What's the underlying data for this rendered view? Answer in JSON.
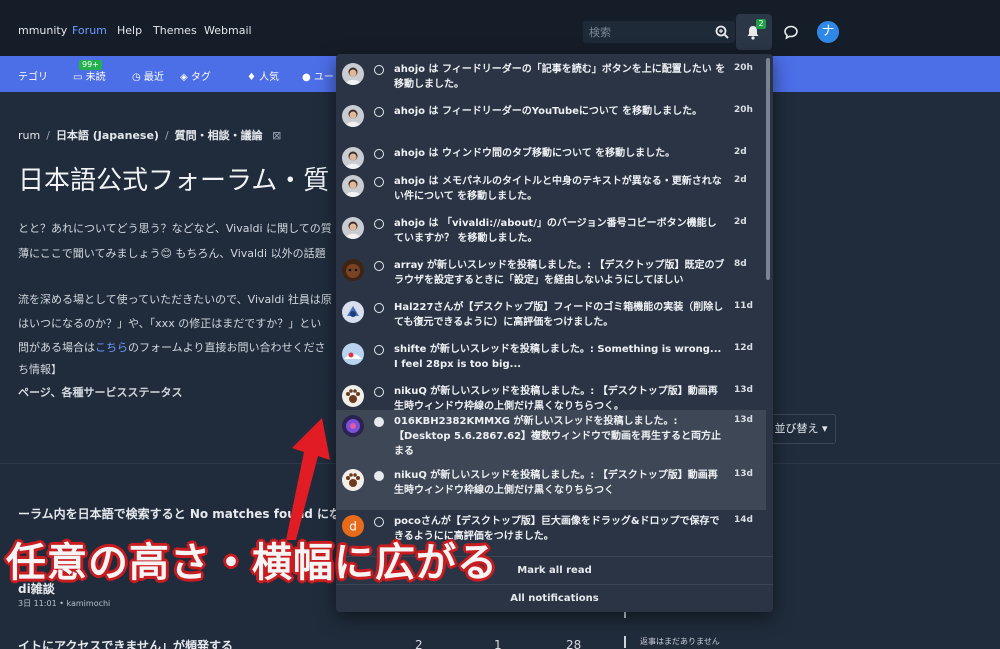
{
  "topnav": {
    "items": [
      "mmunity",
      "Forum",
      "Help",
      "Themes",
      "Webmail"
    ],
    "search_placeholder": "検索",
    "notification_count": "2"
  },
  "forumnav": {
    "items": [
      "テゴリ",
      "未読",
      "最近",
      "タグ",
      "人気",
      "ユー"
    ],
    "unread_badge": "99+"
  },
  "page": {
    "breadcrumb": [
      "rum",
      "日本語 (Japanese)",
      "質問・相談・議論"
    ],
    "title": "日本語公式フォーラム・質",
    "intro_line1": "とと？あれについてどう思う？などなど、Vivaldi に関しての質",
    "intro_line2": "薄にここで聞いてみましょう😊 もちろん、Vivaldi 以外の話題",
    "para_line1": "流を深める場として使っていただきたいので、Vivaldi 社員は原",
    "para_line2": "はいつになるのか？」や、「xxx の修正はまだですか？」とい",
    "para_line3_a": "問がある場合は",
    "para_line3_link": "こちら",
    "para_line3_b": "のフォームより直接お問い合わせくださ",
    "info_heading": "ち情報】",
    "info_links": "ページ、各種サービスステータス",
    "sort_button": "並び替え",
    "topic1": "ーラム内を日本語で検索すると No matches found にな",
    "topic2_title": "di雑談",
    "topic2_meta": "3日 11:01 • kamimochi",
    "topic3": "イトにアクセスできません」が頻発する",
    "topic3_stats": [
      "2",
      "1",
      "28"
    ],
    "topic3_reply": "返事はまだありません"
  },
  "notifications": {
    "items": [
      {
        "text": "ahojo は フィードリーダーの「記事を読む」ボタンを上に配置したい を移動しました。",
        "time": "20h",
        "avatar": "person",
        "unread": false
      },
      {
        "text": "ahojo は フィードリーダーのYouTubeについて を移動しました。",
        "time": "20h",
        "avatar": "person",
        "unread": false
      },
      {
        "text": "ahojo は ウィンドウ間のタブ移動について を移動しました。",
        "time": "2d",
        "avatar": "person",
        "unread": false
      },
      {
        "text": "ahojo は メモパネルのタイトルと中身のテキストが異なる・更新されない件について を移動しました。",
        "time": "2d",
        "avatar": "person",
        "unread": false
      },
      {
        "text": "ahojo は 「vivaldi://about/」のバージョン番号コピーボタン機能していますか？ を移動しました。",
        "time": "2d",
        "avatar": "person",
        "unread": false
      },
      {
        "text": "array が新しいスレッドを投稿しました。: 【デスクトップ版】既定のブラウザを設定するときに「設定」を経由しないようにしてほしい",
        "time": "8d",
        "avatar": "brown",
        "unread": false
      },
      {
        "text": "Hal227さんが【デスクトップ版】フィードのゴミ箱機能の実装（削除しても復元できるように）に高評価をつけました。",
        "time": "11d",
        "avatar": "blue",
        "unread": false
      },
      {
        "text": "shifte が新しいスレッドを投稿しました。: Something is wrong... I feel 28px is too big...",
        "time": "12d",
        "avatar": "sky",
        "unread": false
      },
      {
        "text": "nikuQ が新しいスレッドを投稿しました。: 【デスクトップ版】動画再生時ウィンドウ枠線の上側だけ黒くなりちらつく。",
        "time": "13d",
        "avatar": "paw",
        "unread": false
      },
      {
        "text": "016KBH2382KMMXG が新しいスレッドを投稿しました。: 【Desktop 5.6.2867.62】複数ウィンドウで動画を再生すると両方止まる",
        "time": "13d",
        "avatar": "purple",
        "unread": true
      },
      {
        "text": "nikuQ が新しいスレッドを投稿しました。: 【デスクトップ版】動画再生時ウィンドウ枠線の上側だけ黒くなりちらつく",
        "time": "13d",
        "avatar": "paw",
        "unread": true
      },
      {
        "text": "pocoさんが【デスクトップ版】巨大画像をドラッグ&ドロップで保存できるようにに高評価をつけました。",
        "time": "14d",
        "avatar": "letter-d",
        "unread": false
      }
    ],
    "mark_all_read": "Mark all read",
    "all_notifications": "All notifications"
  },
  "annotation": {
    "caption": "任意の高さ・横幅に広がる",
    "color": "#c91c20"
  }
}
